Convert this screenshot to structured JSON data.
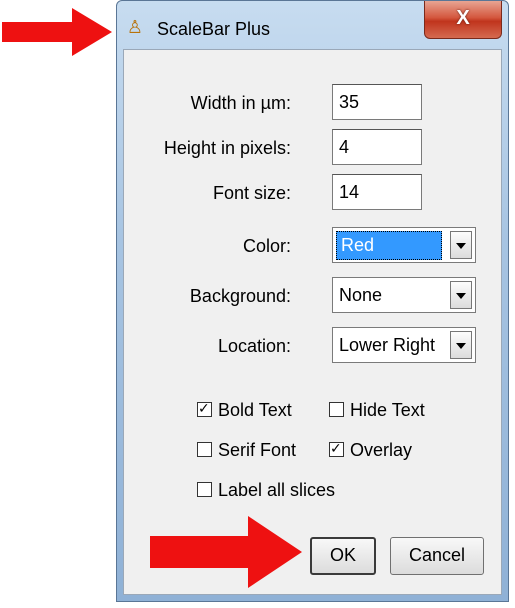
{
  "window": {
    "title": "ScaleBar Plus",
    "close_glyph": "X",
    "app_icon": "microscope-icon"
  },
  "fields": {
    "width_label": "Width in µm:",
    "width_value": "35",
    "height_label": "Height in pixels:",
    "height_value": "4",
    "font_label": "Font size:",
    "font_value": "14"
  },
  "choices": {
    "color_label": "Color:",
    "color_value": "Red",
    "background_label": "Background:",
    "background_value": "None",
    "location_label": "Location:",
    "location_value": "Lower Right"
  },
  "checkboxes": {
    "bold": {
      "label": "Bold Text",
      "checked": true
    },
    "hide": {
      "label": "Hide Text",
      "checked": false
    },
    "serif": {
      "label": "Serif Font",
      "checked": false
    },
    "overlay": {
      "label": "Overlay",
      "checked": true
    },
    "label_all": {
      "label": "Label all slices",
      "checked": false
    }
  },
  "buttons": {
    "ok": "OK",
    "cancel": "Cancel"
  },
  "annotations": {
    "arrow_color": "#ee1111"
  }
}
